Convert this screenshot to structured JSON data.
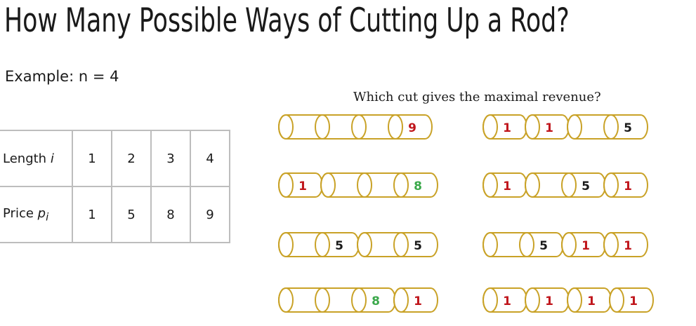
{
  "title": "How Many Possible Ways of Cutting Up a Rod?",
  "example": "Example: n = 4",
  "table": {
    "length_label": "Length",
    "length_var": "i",
    "price_label": "Price",
    "price_var": "p",
    "price_sub": "i",
    "lengths": [
      "1",
      "2",
      "3",
      "4"
    ],
    "prices": [
      "1",
      "5",
      "8",
      "9"
    ]
  },
  "question": "Which cut gives the maximal revenue?",
  "colors": {
    "rod_outline": "#c9a227",
    "red": "#c0161c",
    "green": "#3aa84a",
    "black": "#1a1a1a"
  },
  "cuttings": [
    {
      "pieces": [
        {
          "len": 4,
          "value": "9",
          "color": "red"
        }
      ]
    },
    {
      "pieces": [
        {
          "len": 1,
          "value": "1",
          "color": "red"
        },
        {
          "len": 1,
          "value": "1",
          "color": "red"
        },
        {
          "len": 2,
          "value": "5",
          "color": "black"
        }
      ]
    },
    {
      "pieces": [
        {
          "len": 1,
          "value": "1",
          "color": "red"
        },
        {
          "len": 3,
          "value": "8",
          "color": "green"
        }
      ]
    },
    {
      "pieces": [
        {
          "len": 1,
          "value": "1",
          "color": "red"
        },
        {
          "len": 2,
          "value": "5",
          "color": "black"
        },
        {
          "len": 1,
          "value": "1",
          "color": "red"
        }
      ]
    },
    {
      "pieces": [
        {
          "len": 2,
          "value": "5",
          "color": "black"
        },
        {
          "len": 2,
          "value": "5",
          "color": "black"
        }
      ]
    },
    {
      "pieces": [
        {
          "len": 2,
          "value": "5",
          "color": "black"
        },
        {
          "len": 1,
          "value": "1",
          "color": "red"
        },
        {
          "len": 1,
          "value": "1",
          "color": "red"
        }
      ]
    },
    {
      "pieces": [
        {
          "len": 3,
          "value": "8",
          "color": "green"
        },
        {
          "len": 1,
          "value": "1",
          "color": "red"
        }
      ]
    },
    {
      "pieces": [
        {
          "len": 1,
          "value": "1",
          "color": "red"
        },
        {
          "len": 1,
          "value": "1",
          "color": "red"
        },
        {
          "len": 1,
          "value": "1",
          "color": "red"
        },
        {
          "len": 1,
          "value": "1",
          "color": "red"
        }
      ]
    }
  ]
}
